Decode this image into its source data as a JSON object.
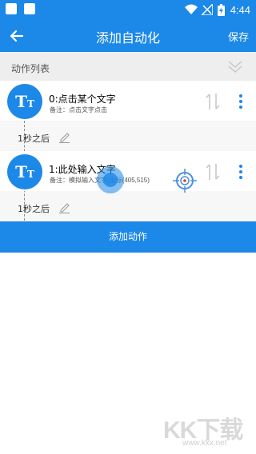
{
  "status_bar": {
    "time": "4:44"
  },
  "app_bar": {
    "title": "添加自动化",
    "save_label": "保存"
  },
  "section": {
    "title": "动作列表"
  },
  "actions": [
    {
      "avatar_text": "T",
      "avatar_sub": "T",
      "title": "0:点击某个文字",
      "note": "备注：点击文字点击",
      "delay": "1秒之后"
    },
    {
      "avatar_text": "T",
      "avatar_sub": "T",
      "title": "1:此处输入文字",
      "note": "备注：模拟输入文字(坐标(405,515)",
      "delay": "1秒之后"
    }
  ],
  "add_action_label": "添加动作",
  "watermark": {
    "logo": "KK下载",
    "url": "www.kkx.net"
  },
  "colors": {
    "accent": "#1c88e8",
    "section_bg": "#eeeeee",
    "list_bg": "#f7f7f7"
  }
}
